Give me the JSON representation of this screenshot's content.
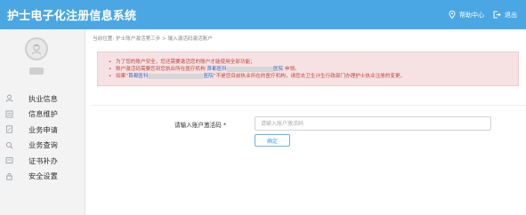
{
  "app": {
    "title": "护士电子化注册信息系统"
  },
  "header": {
    "help_label": "帮助中心",
    "logout_label": "退出"
  },
  "sidebar": {
    "items": [
      {
        "label": "执业信息",
        "icon": "user-card-icon"
      },
      {
        "label": "信息维护",
        "icon": "edit-doc-icon"
      },
      {
        "label": "业务申请",
        "icon": "form-icon"
      },
      {
        "label": "业务查询",
        "icon": "search-doc-icon"
      },
      {
        "label": "证书补办",
        "icon": "certificate-icon"
      },
      {
        "label": "安全设置",
        "icon": "lock-icon"
      }
    ]
  },
  "main": {
    "breadcrumb": "当前位置: 护士账户激活第三步 > 输入激活码激活账户",
    "notice": {
      "line1": "为了您的账户安全，您还需要激活您的账户才能使用全部功能；",
      "line2_pre": "账户激活码需要您到您执业所在医疗机构",
      "line2_link": "首都医科",
      "line2_link_end": "医院",
      "line2_post": "申领。",
      "line3_pre": "如果“",
      "line3_link": "首都医科",
      "line3_link_end": "医院",
      "line3_post": "”不是您目前执业所在的医疗机构，请您去卫生计生行政部门办理护士执业注册的变更。"
    },
    "form": {
      "label": "请输入账户激活码 *",
      "placeholder": "请输入账户激活码",
      "value": "",
      "confirm_label": "确定"
    }
  }
}
